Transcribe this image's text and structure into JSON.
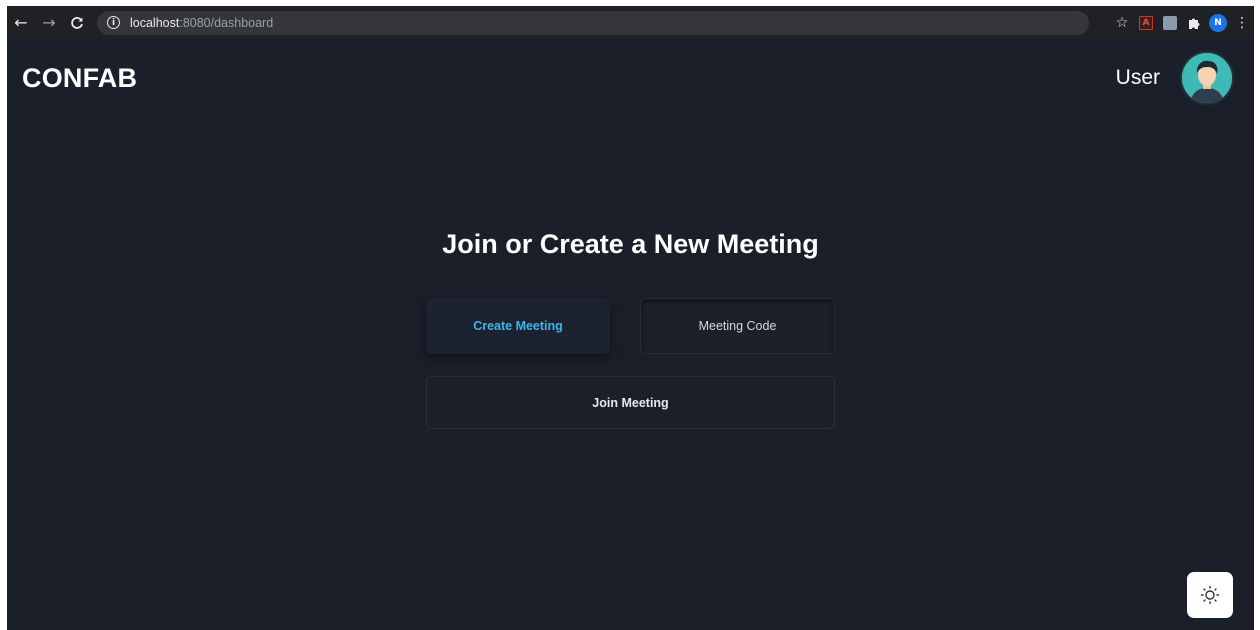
{
  "browser": {
    "url_host": "localhost",
    "url_path": ":8080/dashboard",
    "profile_initial": "N",
    "pdf_label": "A"
  },
  "app": {
    "logo": "CONFAB",
    "user_name": "User",
    "heading": "Join or Create a New Meeting",
    "create_button": "Create Meeting",
    "meeting_code_placeholder": "Meeting Code",
    "meeting_code_value": "",
    "join_button": "Join Meeting"
  },
  "icons": {
    "back": "arrow-left-icon",
    "forward": "arrow-right-icon",
    "reload": "reload-icon",
    "info": "info-icon",
    "star": "star-icon",
    "extensions": "puzzle-icon",
    "menu": "kebab-menu-icon",
    "theme": "sun-icon"
  },
  "colors": {
    "app_background": "#1b1f2a",
    "accent": "#3db6e8",
    "avatar_background": "#3fb9b6",
    "profile": "#1a73e8"
  }
}
